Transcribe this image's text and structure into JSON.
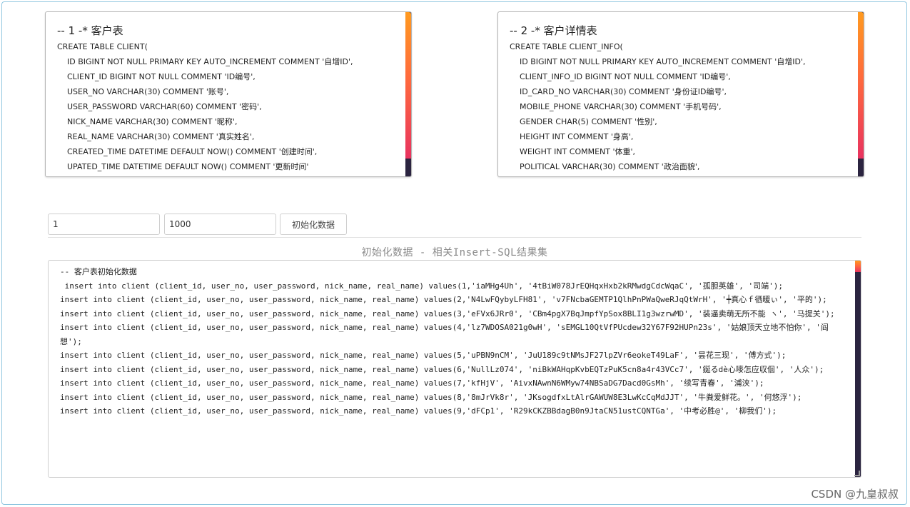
{
  "schema_client": {
    "title": "-- 1 -* 客户表",
    "create": "CREATE TABLE CLIENT(",
    "lines": [
      "ID BIGINT NOT NULL PRIMARY KEY AUTO_INCREMENT COMMENT '自增ID',",
      "CLIENT_ID BIGINT NOT NULL COMMENT 'ID编号',",
      "USER_NO VARCHAR(30) COMMENT '账号',",
      "USER_PASSWORD VARCHAR(60) COMMENT '密码',",
      "NICK_NAME VARCHAR(30) COMMENT '昵称',",
      "REAL_NAME VARCHAR(30) COMMENT '真实姓名',",
      "CREATED_TIME DATETIME DEFAULT NOW() COMMENT '创建时间',",
      "UPATED_TIME DATETIME DEFAULT NOW() COMMENT '更新时间'"
    ]
  },
  "schema_client_info": {
    "title": "-- 2 -* 客户详情表",
    "create": "CREATE TABLE CLIENT_INFO(",
    "lines": [
      "ID BIGINT NOT NULL PRIMARY KEY AUTO_INCREMENT COMMENT '自增ID',",
      "CLIENT_INFO_ID BIGINT NOT NULL COMMENT 'ID编号',",
      "ID_CARD_NO VARCHAR(30) COMMENT '身份证ID编号',",
      "MOBILE_PHONE VARCHAR(30) COMMENT '手机号码',",
      "GENDER CHAR(5) COMMENT '性别',",
      "HEIGHT INT COMMENT '身高',",
      "WEIGHT INT COMMENT '体重',",
      "POLITICAL VARCHAR(30) COMMENT '政治面貌',"
    ]
  },
  "controls": {
    "start_value": "1",
    "end_value": "1000",
    "init_button_label": "初始化数据"
  },
  "result": {
    "title": "初始化数据 - 相关Insert-SQL结果集",
    "text": "-- 客户表初始化数据\n insert into client (client_id, user_no, user_password, nick_name, real_name) values(1,'iaMHg4Uh', '4tBiW078JrEQHqxHxb2kRMwdgCdcWqaC', '孤胆英雄', '司端');\ninsert into client (client_id, user_no, user_password, nick_name, real_name) values(2,'N4LwFQybyLFH81', 'v7FNcbaGEMTP1QlhPnPWaQweRJqQtWrH', '┿真心ｆ徆暖ぃ', '平的');\ninsert into client (client_id, user_no, user_password, nick_name, real_name) values(3,'eFVx6JRr0', 'CBm4pgX7BqJmpfYpSox8BLI1g3wzrwMD', '装逼卖萌无所不能 ヽ', '马提关');\ninsert into client (client_id, user_no, user_password, nick_name, real_name) values(4,'lz7WDOSA021g0wH', 'sEMGL10QtVfPUcdew32Y67F92HUPn23s', '姑娘顶天立地不怕你', '阎想');\ninsert into client (client_id, user_no, user_password, nick_name, real_name) values(5,'uPBN9nCM', 'JuU189c9tNMsJF27lpZVr6eokeT49LaF', '昙花三现', '傅方式');\ninsert into client (client_id, user_no, user_password, nick_name, real_name) values(6,'NullLz074', 'niBkWAHqpKvbEQTzPuK5cn8a4r43VCc7', '鋋るdè心嘜怎应収佪', '人众');\ninsert into client (client_id, user_no, user_password, nick_name, real_name) values(7,'kfHjV', 'AivxNAwnN6WMyw74NBSaDG7Dacd0GsMh', '续写青春', '浦浃');\ninsert into client (client_id, user_no, user_password, nick_name, real_name) values(8,'8mJrVk8r', 'JKsogdfxLtAlrGAWUW8E3LwKcCqMdJJT', '牛粪爱鲜花。', '何悠浮');\ninsert into client (client_id, user_no, user_password, nick_name, real_name) values(9,'dFCp1', 'R29kCKZBBdagB0n9JtaCN51ustCQNTGa', '中考必胜@', '柳我们');"
  },
  "watermark": "CSDN @九皇叔叔"
}
